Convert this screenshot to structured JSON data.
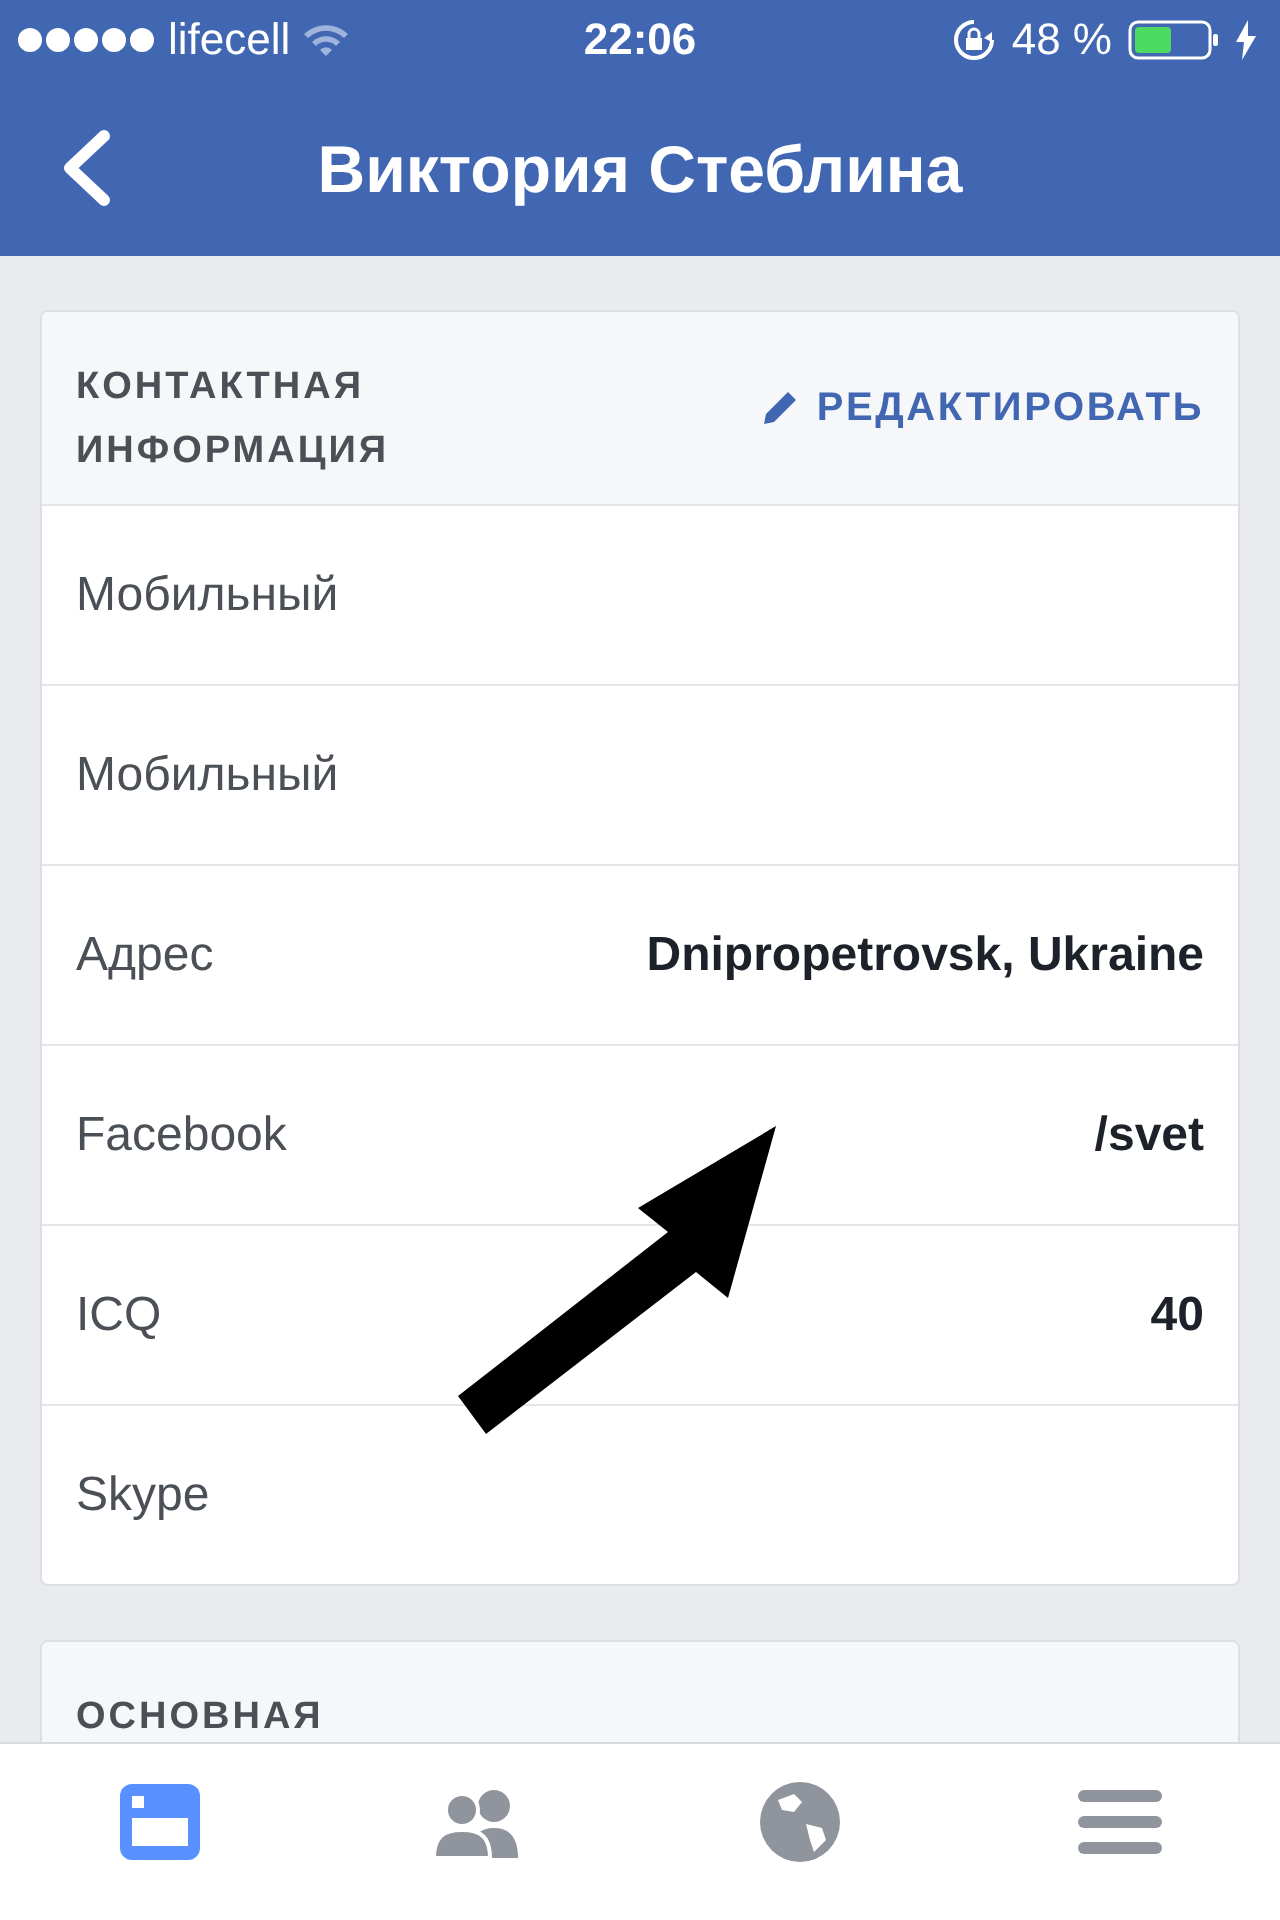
{
  "status_bar": {
    "carrier": "lifecell",
    "time": "22:06",
    "battery": "48 %"
  },
  "nav": {
    "title": "Виктория Стеблина"
  },
  "sections": [
    {
      "title": "КОНТАКТНАЯ ИНФОРМАЦИЯ",
      "edit_label": "РЕДАКТИРОВАТЬ",
      "rows": [
        {
          "label": "Мобильный"
        },
        {
          "label": "Мобильный"
        },
        {
          "label": "Адрес",
          "value": "Dnipropetrovsk, Ukraine"
        },
        {
          "label": "Facebook",
          "value": "/svet"
        },
        {
          "label": "ICQ",
          "value": "40"
        },
        {
          "label": "Skype"
        }
      ]
    },
    {
      "title": "ОСНОВНАЯ"
    }
  ],
  "tabs": [
    {
      "selected": true
    },
    {
      "selected": false
    },
    {
      "selected": false
    },
    {
      "selected": false
    }
  ]
}
